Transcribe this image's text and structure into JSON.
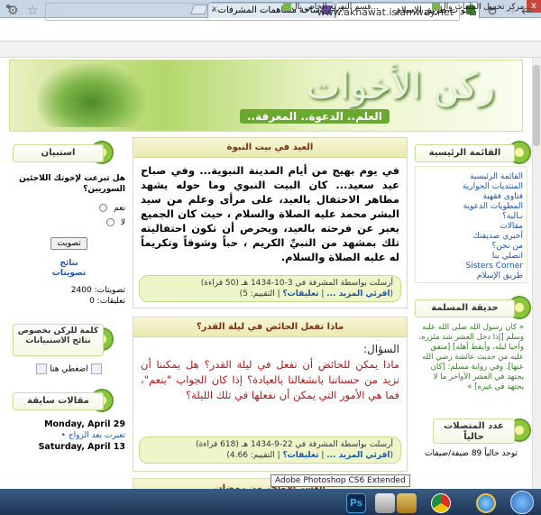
{
  "browser": {
    "tabs": [
      {
        "title": "أخوات طريق الإسلام",
        "close": "x"
      },
      {
        "title": "ساحة مساهمات المشرفات - أخ",
        "close": "x"
      }
    ],
    "url": "www.akhawat.islamway.net",
    "bookmarks": [
      "مركز تحميل الملفات وال...",
      "قسم التفريغ الخاص بال..."
    ],
    "window_min": "–",
    "window_close": "x"
  },
  "banner": {
    "logo": "ركن الأخوات",
    "slogan": "العلم.. الدعوة.. المعرفة.."
  },
  "right": {
    "menu_title": "القائمة الرئيسية",
    "menu_items": [
      "القائمة الرئيسية",
      "المنتديات الحوارية",
      "فتاوى فقهية",
      "المطويات الدعوية",
      "نـالية؟",
      "مقالات",
      "أخبري صديقتك",
      "من نحن؟",
      "اتصلي بنا",
      "Sisters Corner",
      "طريق الإسلام"
    ],
    "garden_title": "حديقة المسلمة",
    "garden_text": "« كان رسول الله صلى الله عليه وسلم [إذا دخل العشر شد مئزره، وأحيا ليله، وأيقظ أهله] [متفق عليه من حديث عائشة رضي الله عنها]. وفي رواية مسلم: [كان يجتهد في العشر الأواخر ما لا يجتهد في غيره] »",
    "online_title": "عدد المتصلات حالياً",
    "online_text": "توجد حالياً 89 ضيفة/ضيفات"
  },
  "left": {
    "poll_title": "استبيان",
    "poll_question": "هل تبرعت لإخوتك اللاجئين السوريين؟",
    "poll_options": [
      "نعم",
      "لا"
    ],
    "vote_button": "تصويت",
    "results_link": "نتائج تصويتات",
    "votes_label": "تصويتات: 2400",
    "comments_label": "تعليقات: 0",
    "word_title": "كلمة للركن بخصوص نتائج الاستبيانات",
    "word_link": "اضغطي هنا",
    "prev_title": "مقالات سابقة",
    "prev_items": [
      {
        "date": "Monday, April 29",
        "link": "تغيرت بعد الزواج"
      },
      {
        "date": "Saturday, April 13",
        "link": ""
      }
    ]
  },
  "articles": [
    {
      "title": "العيد في بيت النبوة",
      "body": "في يوم بهيج من أيام المدينة النبوية... وفي صباح عيد سعيد... كان البيت النبوي وما حوله يشهد مظاهر الاحتفال بالعيد، على مرأى وعلم من سيد البشر محمد عليه الصلاة والسلام ، حيث كان الجميع يعبر عن فرحته بالعيد، ويحرص أن تكون احتفاليته تلك بمشهد من النبيِّ الكريم ، حباً وشوقاً وتكريماً له عليه الصلاة والسلام.",
      "meta": "أرسلت بواسطة المشرفة في 3-10-1434 هـ (50 قراءة)",
      "more": "اقرئي المزيد ...",
      "comments": "تعليقات؟",
      "rating": "التقييم: 5"
    },
    {
      "title": "ماذا تفعل الحائض في ليلة القدر؟",
      "question_label": "السؤال:",
      "body": "ماذا يمكن للحائض أن تفعل في ليلة القدر؟ هل يمكننا أن نزيد من حسناتنا بانشغالنا بالعبادة؟ إذا كان الجواب \"بنعم\"، فما هي الأمور التي يمكن أن نفعلها في تلك الليلة؟",
      "meta": "أرسلت بواسطة المشرفة في 22-9-1434 هـ (618 قراءة)",
      "more": "اقرئي المزيد ...",
      "comments": "تعليقات؟",
      "rating": "التقييم: 4.66"
    },
    {
      "title": "العشر الأواخر من رمضان"
    }
  ],
  "taskbar": {
    "tooltip": "Adobe Photoshop CS6 Extended",
    "ps_label": "Ps"
  }
}
